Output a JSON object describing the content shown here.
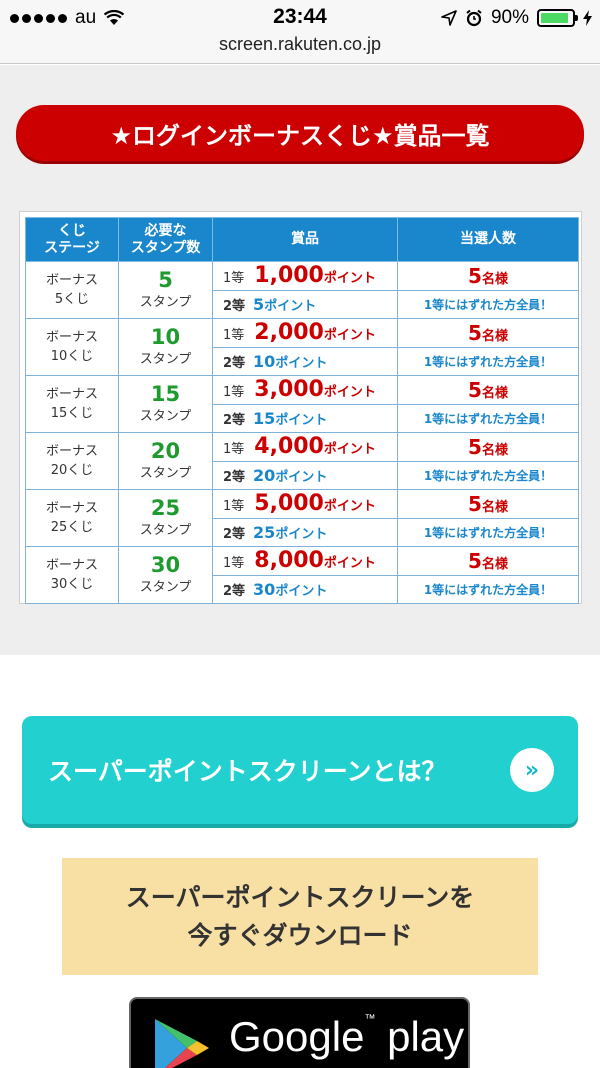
{
  "status_bar": {
    "carrier": "au",
    "time": "23:44",
    "battery": "90%",
    "battery_level": 0.9
  },
  "url_bar": {
    "domain": "screen.rakuten.co.jp"
  },
  "title_banner": {
    "label": "★ログインボーナスくじ★賞品一覧"
  },
  "prize_table": {
    "headers": {
      "stage_line1": "くじ",
      "stage_line2": "ステージ",
      "stamps_line1": "必要な",
      "stamps_line2": "スタンプ数",
      "prize": "賞品",
      "winners": "当選人数"
    },
    "rows": [
      {
        "stage_line1": "ボーナス",
        "stage_line2": "5くじ",
        "stamps": "5",
        "stamps_unit": "スタンプ",
        "p1_rank": "1等",
        "p1_amount": "1,000",
        "p1_unit": "ポイント",
        "p2_rank": "2等",
        "p2_amount": "5",
        "p2_unit": "ポイント",
        "w1_count": "5",
        "w1_unit": "名様",
        "w2_text": "1等にはずれた方全員！"
      },
      {
        "stage_line1": "ボーナス",
        "stage_line2": "10くじ",
        "stamps": "10",
        "stamps_unit": "スタンプ",
        "p1_rank": "1等",
        "p1_amount": "2,000",
        "p1_unit": "ポイント",
        "p2_rank": "2等",
        "p2_amount": "10",
        "p2_unit": "ポイント",
        "w1_count": "5",
        "w1_unit": "名様",
        "w2_text": "1等にはずれた方全員！"
      },
      {
        "stage_line1": "ボーナス",
        "stage_line2": "15くじ",
        "stamps": "15",
        "stamps_unit": "スタンプ",
        "p1_rank": "1等",
        "p1_amount": "3,000",
        "p1_unit": "ポイント",
        "p2_rank": "2等",
        "p2_amount": "15",
        "p2_unit": "ポイント",
        "w1_count": "5",
        "w1_unit": "名様",
        "w2_text": "1等にはずれた方全員！"
      },
      {
        "stage_line1": "ボーナス",
        "stage_line2": "20くじ",
        "stamps": "20",
        "stamps_unit": "スタンプ",
        "p1_rank": "1等",
        "p1_amount": "4,000",
        "p1_unit": "ポイント",
        "p2_rank": "2等",
        "p2_amount": "20",
        "p2_unit": "ポイント",
        "w1_count": "5",
        "w1_unit": "名様",
        "w2_text": "1等にはずれた方全員！"
      },
      {
        "stage_line1": "ボーナス",
        "stage_line2": "25くじ",
        "stamps": "25",
        "stamps_unit": "スタンプ",
        "p1_rank": "1等",
        "p1_amount": "5,000",
        "p1_unit": "ポイント",
        "p2_rank": "2等",
        "p2_amount": "25",
        "p2_unit": "ポイント",
        "w1_count": "5",
        "w1_unit": "名様",
        "w2_text": "1等にはずれた方全員！"
      },
      {
        "stage_line1": "ボーナス",
        "stage_line2": "30くじ",
        "stamps": "30",
        "stamps_unit": "スタンプ",
        "p1_rank": "1等",
        "p1_amount": "8,000",
        "p1_unit": "ポイント",
        "p2_rank": "2等",
        "p2_amount": "30",
        "p2_unit": "ポイント",
        "w1_count": "5",
        "w1_unit": "名様",
        "w2_text": "1等にはずれた方全員！"
      }
    ]
  },
  "about_button": {
    "label": "スーパーポイントスクリーンとは？",
    "icon": "double-chevron-right-icon"
  },
  "download_banner": {
    "line1": "スーパーポイントスクリーンを",
    "line2": "今すぐダウンロード"
  },
  "google_play_badge": {
    "brand": "Google",
    "tm": "™",
    "product": "play",
    "icon": "google-play-triangle-icon"
  },
  "colors": {
    "title_red": "#cc0000",
    "table_header_blue": "#1a87cc",
    "stamp_green": "#1e9a2e",
    "about_cyan": "#22d0d0",
    "download_beige": "#f8e0a4"
  }
}
